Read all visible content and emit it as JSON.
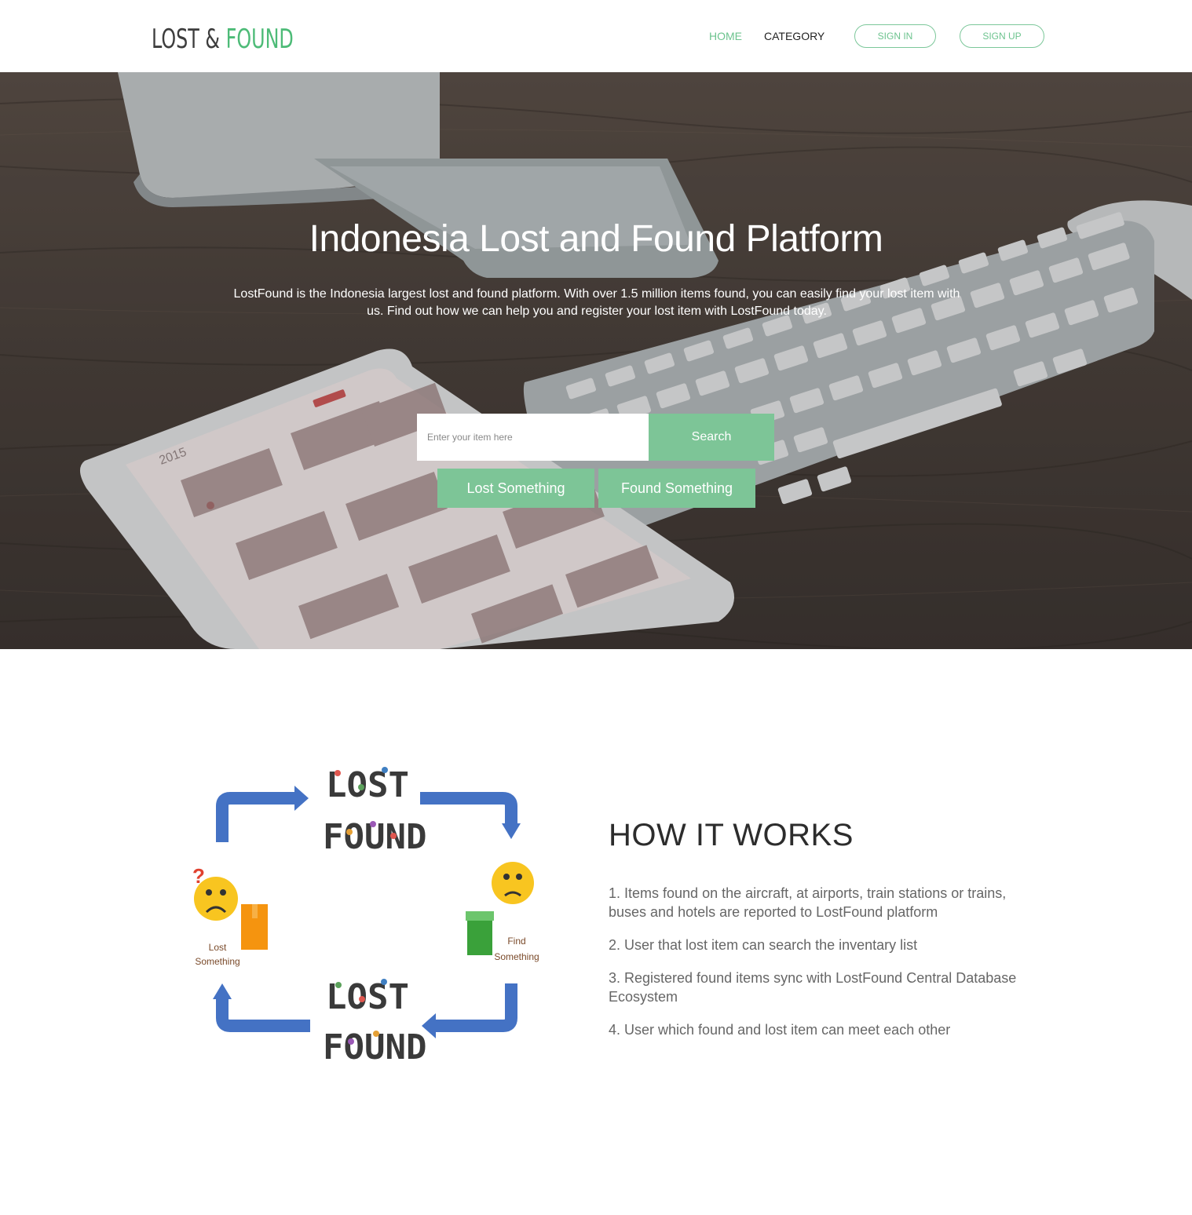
{
  "navbar": {
    "logo_part1": "LOST & ",
    "logo_part2": "FOUND",
    "home": "HOME",
    "category": "CATEGORY",
    "sign_in": "SIGN IN",
    "sign_up": "SIGN UP"
  },
  "hero": {
    "title": "Indonesia Lost and Found Platform",
    "subtitle": "LostFound is the Indonesia largest lost and found platform. With over 1.5 million items found, you can easily find your lost item with us. Find out how we can help you and register your lost item with LostFound today.",
    "search_placeholder": "Enter your item here",
    "search_button": "Search",
    "lost_button": "Lost Something",
    "found_button": "Found Something",
    "tablet_year": "2015"
  },
  "diagram": {
    "lost_label_1": "Lost",
    "lost_label_2": "Something",
    "find_label_1": "Find",
    "find_label_2": "Something",
    "logo_top": "LOST",
    "logo_bottom": "FOUND"
  },
  "how": {
    "title": "HOW IT WORKS",
    "steps": [
      "1. Items found on the aircraft, at airports, train stations or trains, buses and hotels are reported to LostFound platform",
      "2. User that lost item can search the inventary list",
      "3. Registered found items sync with LostFound Central Database Ecosystem",
      "4. User which found and lost item can meet each other"
    ]
  },
  "colors": {
    "accent": "#7dc597",
    "logo_green": "#4dbb77",
    "arrow_blue": "#4472c4",
    "emoji_yellow": "#f8c520"
  }
}
